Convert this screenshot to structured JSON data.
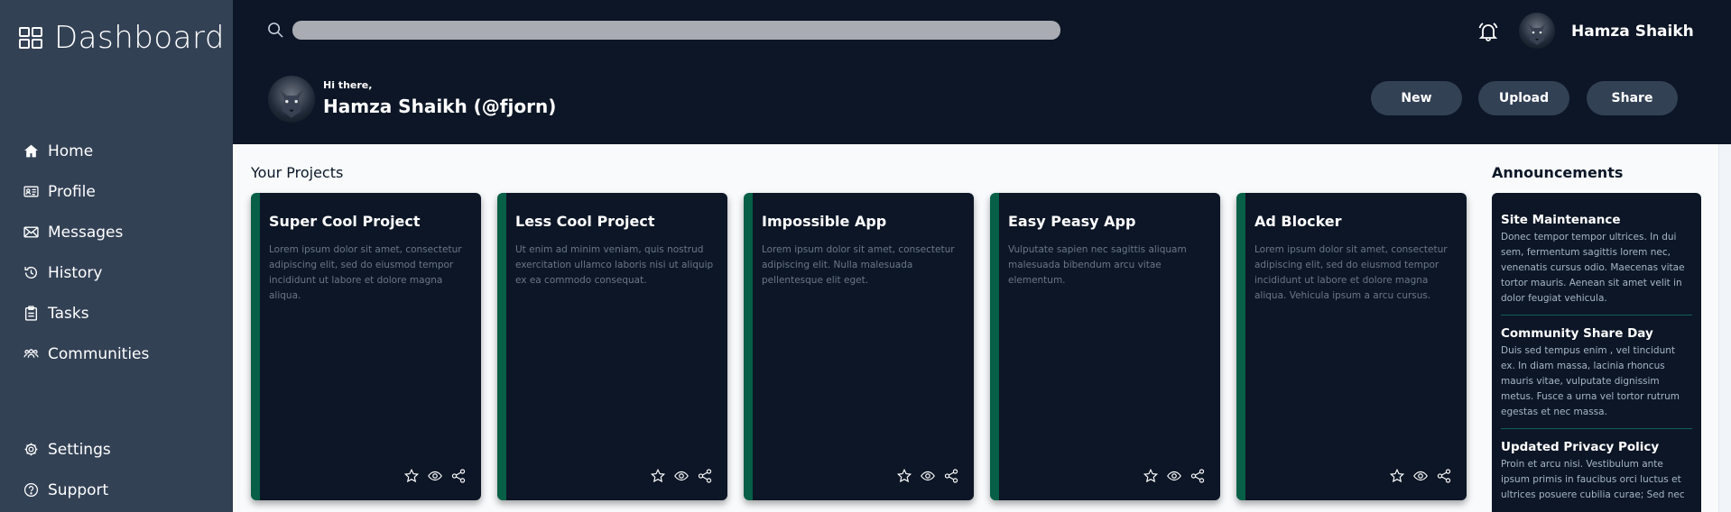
{
  "sidebar": {
    "brand": "Dashboard",
    "items": [
      {
        "label": "Home",
        "icon": "home-icon"
      },
      {
        "label": "Profile",
        "icon": "profile-card-icon"
      },
      {
        "label": "Messages",
        "icon": "envelope-icon"
      },
      {
        "label": "History",
        "icon": "history-icon"
      },
      {
        "label": "Tasks",
        "icon": "clipboard-icon"
      },
      {
        "label": "Communities",
        "icon": "people-icon"
      }
    ],
    "footer": [
      {
        "label": "Settings",
        "icon": "gear-icon"
      },
      {
        "label": "Support",
        "icon": "question-icon"
      }
    ]
  },
  "header": {
    "search_placeholder": "",
    "user_name": "Hamza Shaikh",
    "greeting": "Hi there,",
    "greeting_name": "Hamza Shaikh (@fjorn)",
    "buttons": {
      "new": "New",
      "upload": "Upload",
      "share": "Share"
    }
  },
  "projects": {
    "title": "Your Projects",
    "cards": [
      {
        "title": "Super Cool Project",
        "desc": "Lorem ipsum dolor sit amet, consectetur adipiscing elit, sed do eiusmod tempor incididunt ut labore et dolore magna aliqua."
      },
      {
        "title": "Less Cool Project",
        "desc": "Ut enim ad minim veniam, quis nostrud exercitation ullamco laboris nisi ut aliquip ex ea commodo consequat."
      },
      {
        "title": "Impossible App",
        "desc": "Lorem ipsum dolor sit amet, consectetur adipiscing elit. Nulla malesuada pellentesque elit eget."
      },
      {
        "title": "Easy Peasy App",
        "desc": "Vulputate sapien nec sagittis aliquam malesuada bibendum arcu vitae elementum."
      },
      {
        "title": "Ad Blocker",
        "desc": "Lorem ipsum dolor sit amet, consectetur adipiscing elit, sed do eiusmod tempor incididunt ut labore et dolore magna aliqua. Vehicula ipsum a arcu cursus."
      }
    ]
  },
  "announcements": {
    "title": "Announcements",
    "items": [
      {
        "title": "Site Maintenance",
        "body": "Donec tempor tempor ultrices. In dui sem, fermentum sagittis lorem nec, venenatis cursus odio. Maecenas vitae tortor mauris. Aenean sit amet velit in dolor feugiat vehicula."
      },
      {
        "title": "Community Share Day",
        "body": "Duis sed tempus enim , vel tincidunt ex. In diam massa, lacinia rhoncus mauris vitae, vulputate dignissim metus. Fusce a urna vel tortor rutrum egestas et nec massa."
      },
      {
        "title": "Updated Privacy Policy",
        "body": "Proin et arcu nisi. Vestibulum ante ipsum primis in faucibus orci luctus et ultrices posuere cubilia curae; Sed nec"
      }
    ]
  },
  "colors": {
    "sidebar_bg": "#334155",
    "header_bg": "#0c1626",
    "card_bg": "#0c1626",
    "card_accent": "#065f46",
    "button_bg": "#334155",
    "main_bg": "#f8fafc"
  }
}
